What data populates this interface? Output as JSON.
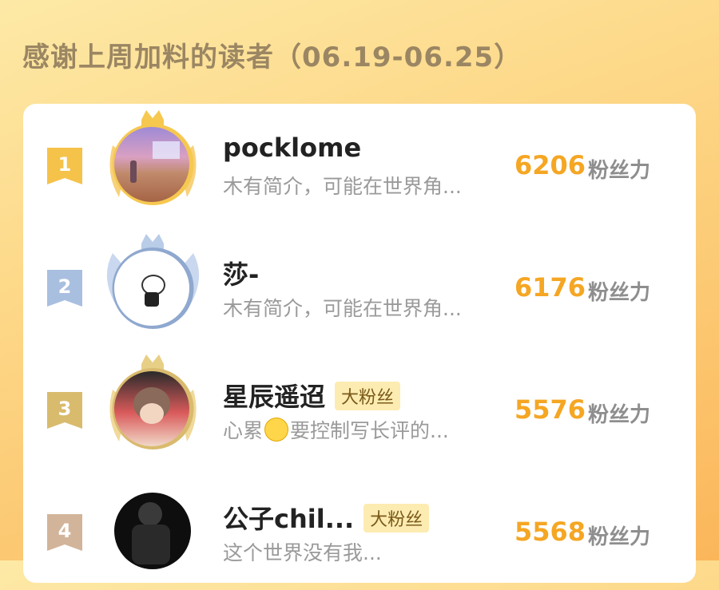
{
  "header": {
    "title": "感谢上周加料的读者（06.19-06.25）"
  },
  "readers": [
    {
      "rank": "1",
      "name": "pocklome",
      "badge": "",
      "bio": "木有简介，可能在世界角...",
      "score": "6206",
      "unit": "粉丝力",
      "rank_color": "#f5c24a"
    },
    {
      "rank": "2",
      "name": "莎-",
      "badge": "",
      "bio": "木有简介，可能在世界角...",
      "score": "6176",
      "unit": "粉丝力",
      "rank_color": "#a9bfe0"
    },
    {
      "rank": "3",
      "name": "星辰遥迢",
      "badge": "大粉丝",
      "bio_before": "心累",
      "bio_after": "要控制写长评的...",
      "score": "5576",
      "unit": "粉丝力",
      "rank_color": "#d9bb6e"
    },
    {
      "rank": "4",
      "name": "公子chil...",
      "badge": "大粉丝",
      "bio": "这个世界没有我...",
      "score": "5568",
      "unit": "粉丝力",
      "rank_color": "#d2b49a"
    }
  ]
}
